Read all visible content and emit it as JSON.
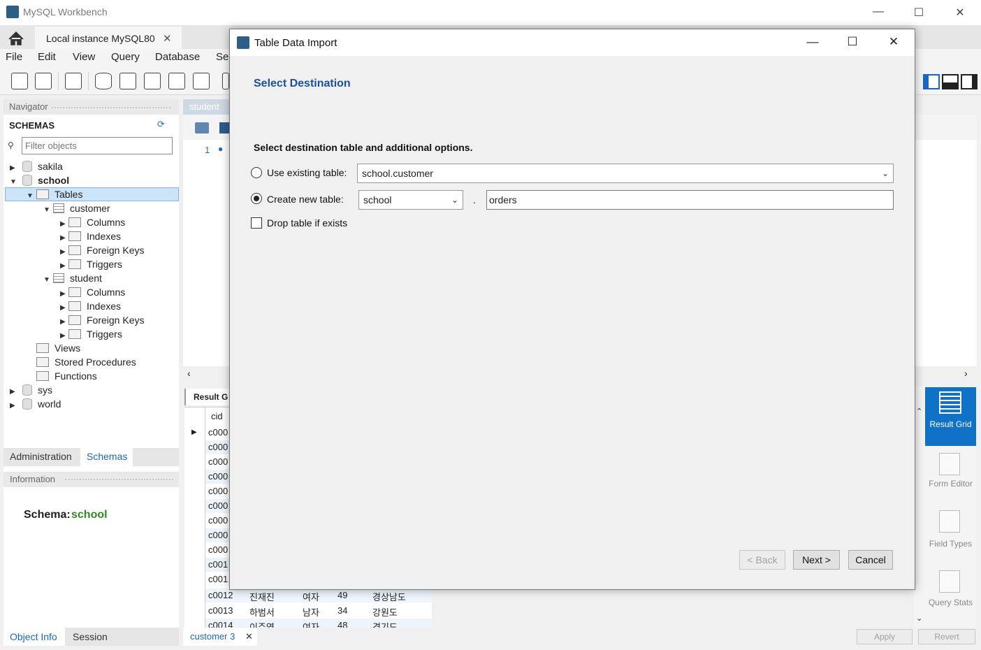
{
  "app": {
    "title": "MySQL Workbench",
    "instance_tab": "Local instance MySQL80",
    "menu": [
      "File",
      "Edit",
      "View",
      "Query",
      "Database",
      "Se"
    ]
  },
  "navigator": {
    "header": "Navigator",
    "schemas_label": "SCHEMAS",
    "filter_placeholder": "Filter objects",
    "tree": {
      "sakila": "sakila",
      "school": "school",
      "tables": "Tables",
      "customer": "customer",
      "student": "student",
      "columns": "Columns",
      "indexes": "Indexes",
      "foreign_keys": "Foreign Keys",
      "triggers": "Triggers",
      "views": "Views",
      "stored_procedures": "Stored Procedures",
      "functions": "Functions",
      "sys": "sys",
      "world": "world"
    },
    "tabs": {
      "administration": "Administration",
      "schemas": "Schemas"
    },
    "info_header": "Information",
    "schema_label": "Schema:",
    "schema_value": "school",
    "bottom_tabs": {
      "object_info": "Object Info",
      "session": "Session"
    }
  },
  "editor": {
    "tab": "student",
    "line_no": "1",
    "result_tab": "Result G",
    "col_header": "cid",
    "rows": [
      [
        "c000"
      ],
      [
        "c000"
      ],
      [
        "c000"
      ],
      [
        "c000"
      ],
      [
        "c000"
      ],
      [
        "c000"
      ],
      [
        "c000"
      ],
      [
        "c000"
      ],
      [
        "c000"
      ],
      [
        "c001"
      ],
      [
        "c001"
      ],
      [
        "c0012",
        "진재진",
        "여자",
        "49",
        "경상남도"
      ],
      [
        "c0013",
        "하범서",
        "남자",
        "34",
        "강원도"
      ],
      [
        "c0014",
        "이주영",
        "여자",
        "48",
        "경기도"
      ]
    ],
    "bottom_tab": "customer 3",
    "apply": "Apply",
    "revert": "Revert"
  },
  "side_panel": {
    "result_grid": "Result Grid",
    "form_editor": "Form Editor",
    "field_types": "Field Types",
    "query_stats": "Query Stats"
  },
  "dialog": {
    "title": "Table Data Import",
    "heading": "Select Destination",
    "subtitle": "Select destination table and additional options.",
    "use_existing_label": "Use existing table:",
    "existing_table_value": "school.customer",
    "create_new_label": "Create new table:",
    "schema_select_value": "school",
    "dot_separator": ".",
    "new_table_name": "orders",
    "drop_table_label": "Drop table if exists",
    "selected_option": "create_new",
    "buttons": {
      "back": "< Back",
      "next": "Next >",
      "cancel": "Cancel"
    }
  },
  "colors": {
    "accent_blue": "#1b4fa0",
    "schema_green": "#2e8b1e",
    "selection_bg": "#cce4f7",
    "result_grid_active": "#0f72c7"
  }
}
